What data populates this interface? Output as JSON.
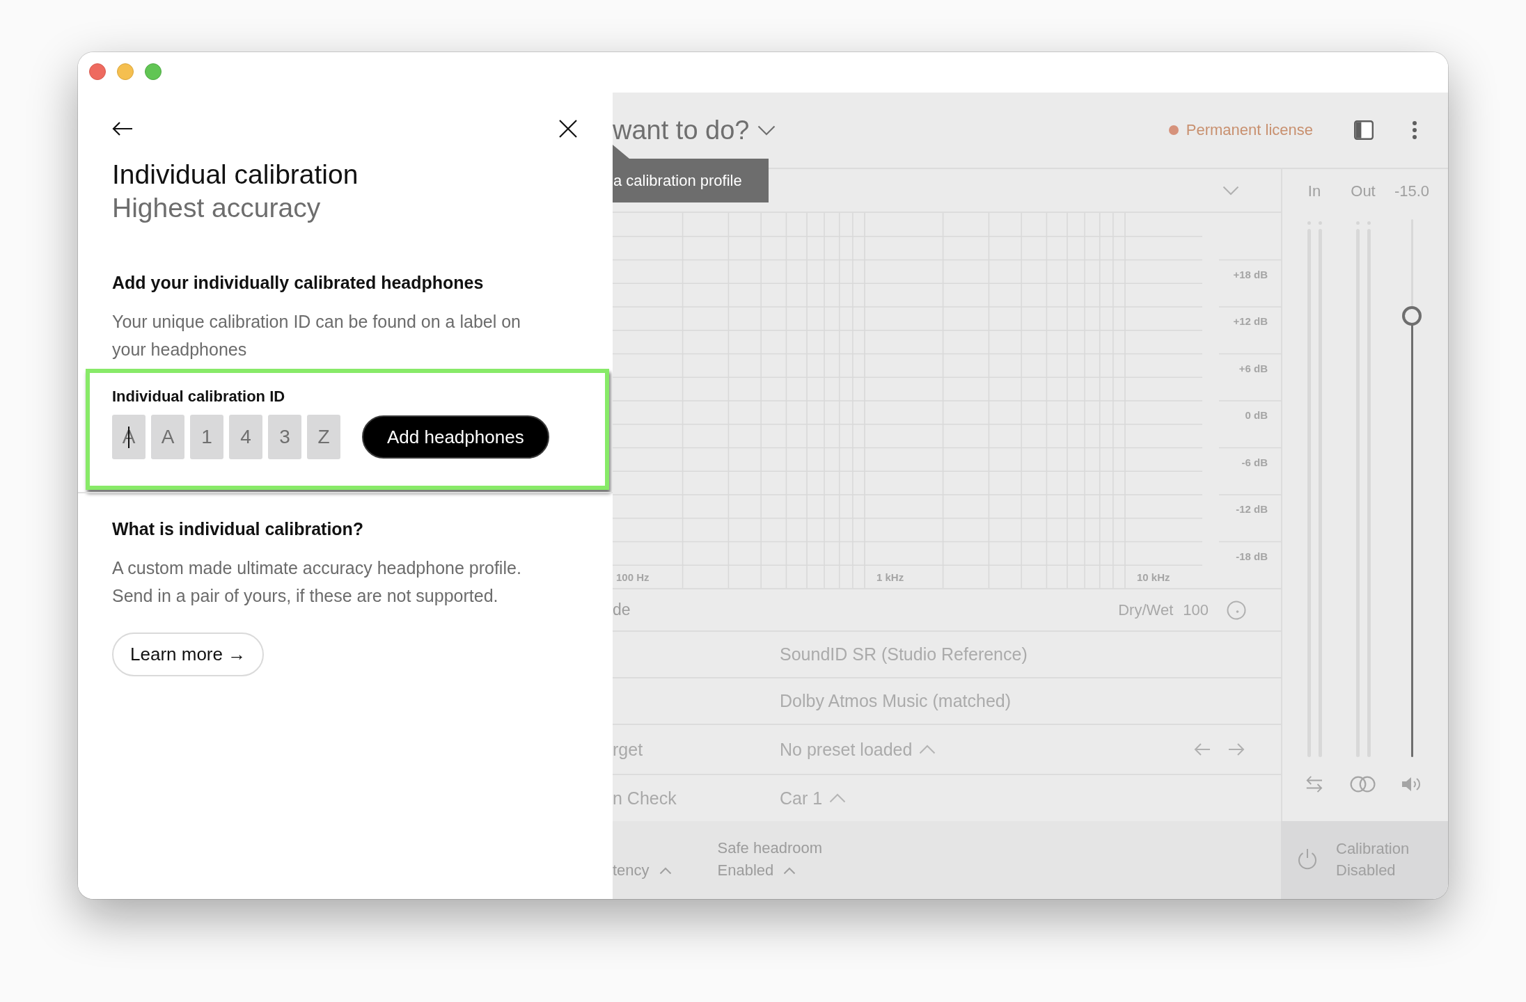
{
  "dialog": {
    "title": "Individual calibration",
    "subtitle": "Highest accuracy",
    "add_section": {
      "heading": "Add your individually calibrated headphones",
      "description": "Your unique calibration ID can be found on a label on your headphones",
      "highlighted": true,
      "id_label": "Individual calibration ID",
      "id_characters": [
        {
          "value": "A",
          "focused": true
        },
        {
          "value": "A",
          "focused": false
        },
        {
          "value": "1",
          "focused": false
        },
        {
          "value": "4",
          "focused": false
        },
        {
          "value": "3",
          "focused": false
        },
        {
          "value": "Z",
          "focused": false
        }
      ],
      "button": "Add headphones"
    },
    "info_section": {
      "heading": "What is individual calibration?",
      "text": "A custom made ultimate accuracy headphone profile. Send in a pair of yours, if these are not supported.",
      "button": "Learn more →"
    }
  },
  "main": {
    "header": {
      "title": "want to do?",
      "license": "Permanent license"
    },
    "tooltip": "a calibration profile",
    "graph": {
      "x_labels": [
        "100 Hz",
        "1 kHz",
        "10 kHz"
      ],
      "y_labels": [
        "+18 dB",
        "+12 dB",
        "+6 dB",
        "0 dB",
        "-6 dB",
        "-12 dB",
        "-18 dB"
      ]
    },
    "mix_row": {
      "label": "de",
      "dry_wet_label": "Dry/Wet",
      "dry_wet_value": "100"
    },
    "rows": [
      {
        "kind": "text",
        "value": "SoundID SR (Studio Reference)"
      },
      {
        "kind": "text",
        "value": "Dolby Atmos Music (matched)"
      },
      {
        "kind": "preset",
        "label": "rget",
        "value": "No preset loaded"
      },
      {
        "kind": "dropdown",
        "label": "n Check",
        "value": "Car 1"
      }
    ],
    "footer": [
      {
        "value": "tency"
      },
      {
        "title": "Safe headroom",
        "value": "Enabled"
      }
    ]
  },
  "meters": {
    "channels": [
      {
        "label": "In"
      },
      {
        "label": "Out"
      }
    ],
    "volume": {
      "reading": "-15.0",
      "level": 0.82
    }
  },
  "calibration": {
    "label": "Calibration",
    "value": "Disabled"
  }
}
